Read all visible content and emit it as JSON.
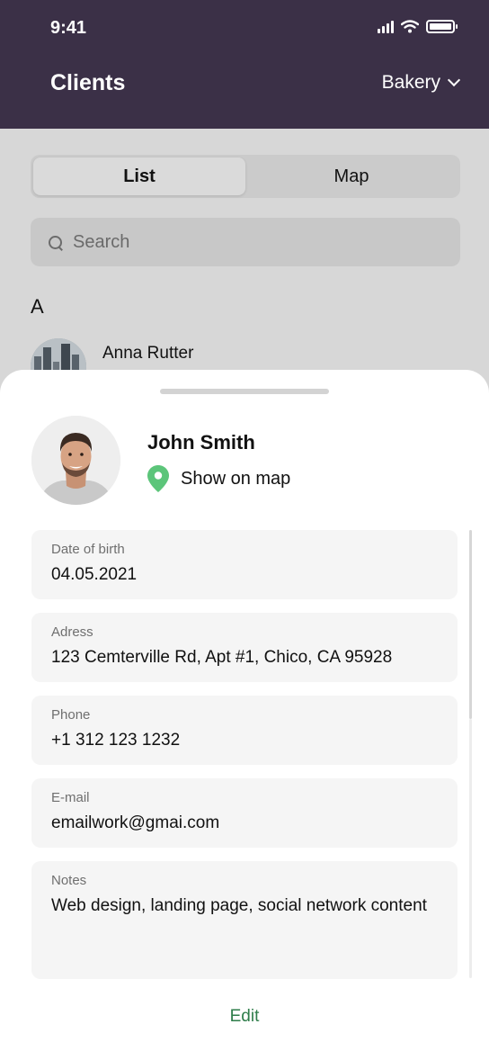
{
  "status_bar": {
    "time": "9:41"
  },
  "header": {
    "title": "Clients",
    "dropdown_label": "Bakery"
  },
  "view_toggle": {
    "options": [
      "List",
      "Map"
    ],
    "selected": "List"
  },
  "search": {
    "placeholder": "Search"
  },
  "client_list": {
    "section_letter": "A",
    "items": [
      {
        "name": "Anna Rutter"
      }
    ]
  },
  "profile": {
    "name": "John Smith",
    "map_link_label": "Show on map",
    "fields": [
      {
        "label": "Date of birth",
        "value": "04.05.2021"
      },
      {
        "label": "Adress",
        "value": "123 Cemterville Rd, Apt #1, Chico, CA 95928"
      },
      {
        "label": "Phone",
        "value": "+1 312 123 1232"
      },
      {
        "label": "E-mail",
        "value": "emailwork@gmai.com"
      },
      {
        "label": "Notes",
        "value": "Web design, landing page, social network content"
      }
    ],
    "edit_label": "Edit"
  },
  "colors": {
    "header_bg": "#3b3047",
    "accent_green": "#2e7d4a",
    "map_pin": "#5cc57a"
  },
  "icons": {
    "signal": "signal-icon",
    "wifi": "wifi-icon",
    "battery": "battery-icon",
    "dropdown": "chevron-down-icon",
    "search": "search-icon",
    "map_pin": "map-pin-icon"
  }
}
